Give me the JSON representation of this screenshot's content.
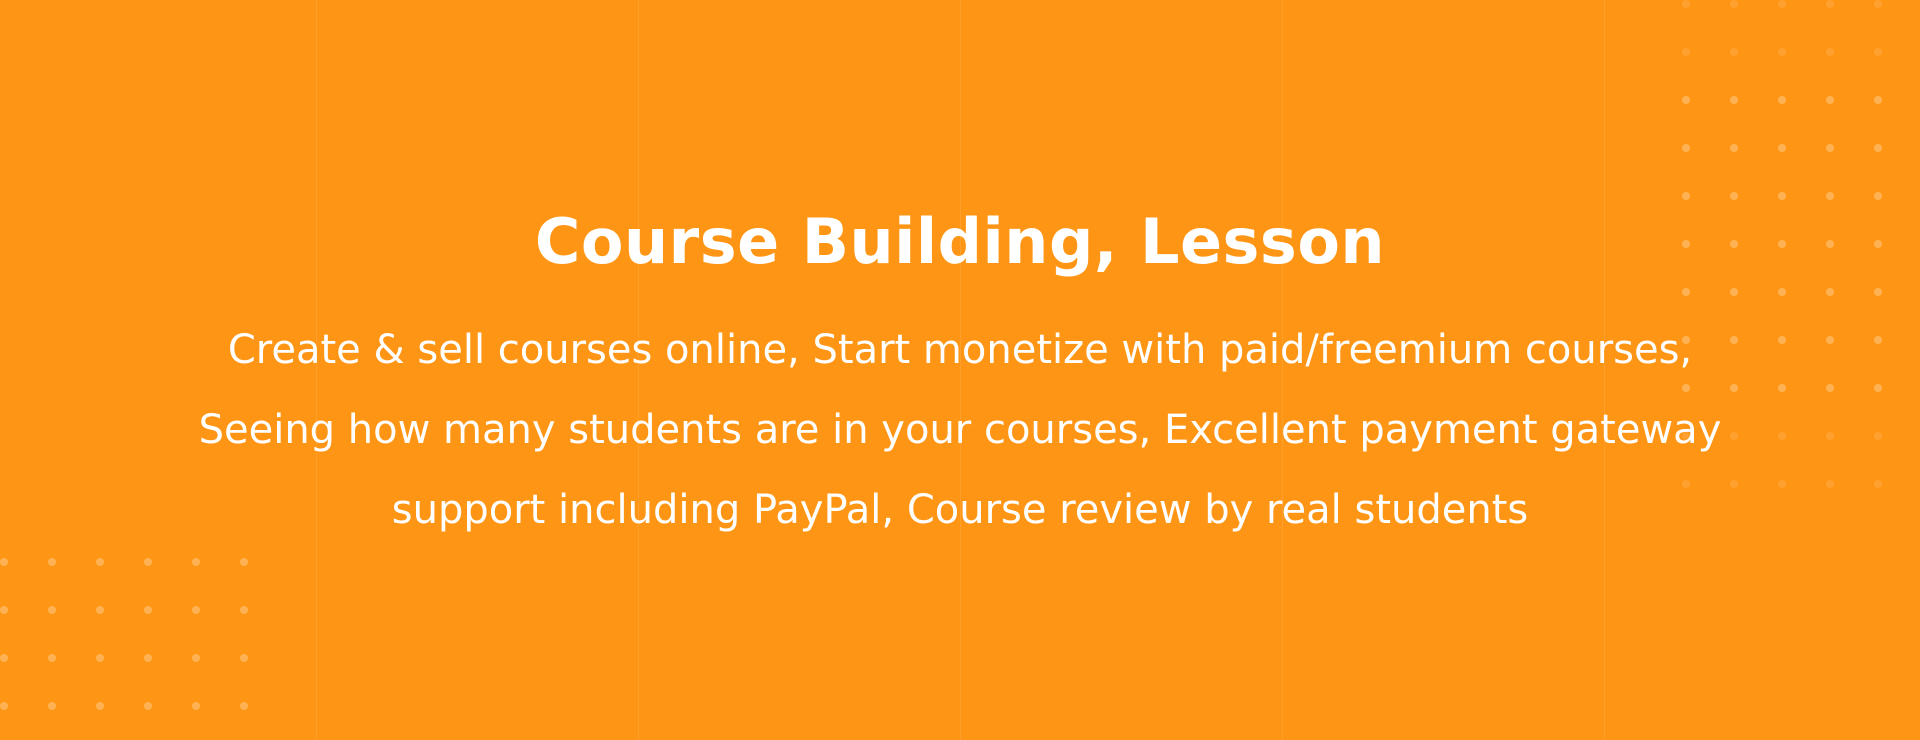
{
  "hero": {
    "title": "Course Building, Lesson",
    "description_lines": [
      "Create & sell courses online, Start monetize with paid/freemium courses,",
      "Seeing how many students are in your courses, Excellent payment gateway",
      "support including PayPal, Course review by real students"
    ]
  },
  "theme": {
    "background_color": "#FF9514",
    "text_color": "#FFFFFF"
  }
}
